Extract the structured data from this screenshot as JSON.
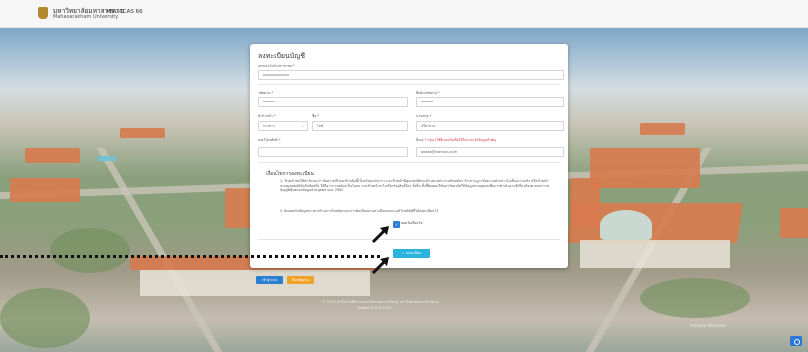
{
  "header": {
    "brand_th": "มหาวิทยาลัยมหาสารคาม",
    "brand_en": "Mahasarakham University",
    "system_name": "MSU-TCAS 66"
  },
  "form": {
    "title": "ลงทะเบียนบัญชี",
    "id_card": {
      "label": "เลขประจำตัวประชาชน",
      "required": "*",
      "value": "xxxxxxxxxxxxx"
    },
    "password": {
      "label": "รหัสผ่าน",
      "required": "*",
      "value": "••••••"
    },
    "password_confirm": {
      "label": "ยืนยันรหัสผ่าน",
      "required": "*",
      "value": "••••••"
    },
    "prefix": {
      "label": "คำนำหน้า",
      "required": "*",
      "value": "นางสาว"
    },
    "firstname": {
      "label": "ชื่อ",
      "required": "*",
      "value": "ไอซ์"
    },
    "lastname": {
      "label": "นามสกุล",
      "required": "*",
      "value": "ปรีดาธาน"
    },
    "phone": {
      "label": "เบอร์โทรศัพท์",
      "required": "*",
      "value": ""
    },
    "email": {
      "label": "อีเมล",
      "warning": "* กรุณาใช้อีเมลจริงเพื่อใช้ในการแจ้งข้อมูลสำคัญ",
      "value": "pedaa@hotmail.co.th"
    }
  },
  "terms": {
    "title": "เงื่อนไขการลงทะเบียน",
    "item1": "1. ข้าพเจ้าขอให้คำรับรองว่า ข้อความที่กรอกข้างต้นนี้เป็นจริงทุกประการ และข้าพเจ้ามีคุณสมบัติครบถ้วนตามประกาศรับสมัคร ถ้าปรากฏว่าข้อความดังกล่าวไม่เป็นความจริง หรือข้าพเจ้าขาดคุณสมบัติข้อใดข้อหนึ่ง ให้ถือว่าการสมัครเป็นโมฆะ และข้าพเจ้าจะไม่เรียกร้องสิทธิ์ใดๆ ทั้งสิ้น ทั้งนี้ยินยอมให้มหาวิทยาลัยใช้ข้อมูลส่วนบุคคลเพื่อการดำเนินงานที่เกี่ยวข้องตามพระราชบัญญัติคุ้มครองข้อมูลส่วนบุคคล พ.ศ. 2562",
    "item2": "2. ยินยอมรับข้อมูลข่าวสารด้านการรับสมัครและการคัดเลือกผ่านทางอีเมลและเบอร์โทรศัพท์ที่ได้ลงทะเบียนไว้",
    "accept_label": "ยอมรับเงื่อนไข",
    "checked_glyph": "✓"
  },
  "buttons": {
    "register": "✓ ลงทะเบียน",
    "login": "เข้าสู่ระบบ",
    "forgot": "ลืมรหัสผ่าน"
  },
  "footer": {
    "line1": "© 2022 สำนักการศึกษาและนวัตกรรมการเรียนรู้ มหาวิทยาลัยมหาสารคาม",
    "line2": "โทรศัพท์ 043-754333"
  },
  "watermark": "Activate Windows",
  "colors": {
    "register_button": "#2bb3df",
    "login_button": "#2a7fd0",
    "forgot_button": "#f0a229",
    "required_mark": "#dd3333"
  }
}
